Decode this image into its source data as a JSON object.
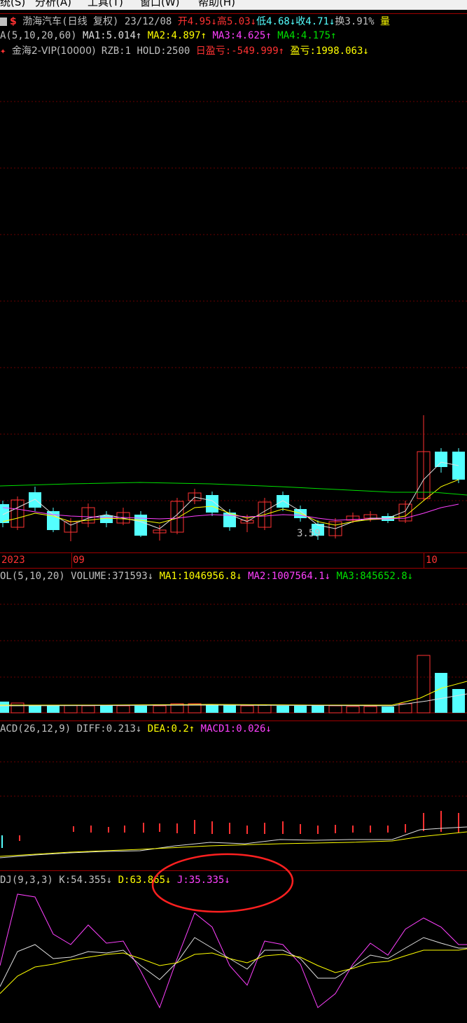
{
  "menu": [
    "统(S)",
    "分析(A)",
    "工具(T)",
    "窗口(W)",
    "帮助(H)"
  ],
  "header": {
    "title": "渤海汽车(日线 复权)",
    "date": "23/12/08",
    "open": "开4.95",
    "high": "高5.03",
    "low": "低4.68",
    "close": "收4.71",
    "turnover": "换3.91%",
    "volume_label": "量"
  },
  "ma_row": {
    "name": "A(5,10,20,60)",
    "ma1": "MA1:5.014",
    "ma2": "MA2:4.897",
    "ma3": "MA3:4.625",
    "ma4": "MA4:4.175"
  },
  "strategy_row": {
    "name": "金海2-VIP(10000)",
    "rzb": "RZB:1",
    "hold": "HOLD:2500",
    "day_pl": "日盈亏:-549.999",
    "pl": "盈亏:1998.063"
  },
  "low_marker": "3.59",
  "date_axis": [
    "2023",
    "09",
    "10"
  ],
  "vol_row": {
    "name": "OL(5,10,20)",
    "volume": "VOLUME:371593",
    "ma1": "MA1:1046956.8",
    "ma2": "MA2:1007564.1",
    "ma3": "MA3:845652.8"
  },
  "macd_row": {
    "name": "ACD(26,12,9)",
    "diff": "DIFF:0.213",
    "dea": "DEA:0.2",
    "macd": "MACD1:0.026"
  },
  "kdj_row": {
    "name": "DJ(9,3,3)",
    "k": "K:54.355",
    "d": "D:63.865",
    "j": "J:35.335"
  },
  "colors": {
    "up": "#ff3232",
    "down": "#54ffff",
    "ma1": "#e0e0e0",
    "ma2": "#ffff00",
    "ma3": "#ff40ff",
    "ma4": "#00e000",
    "annotation": "#ff2020"
  },
  "arrows": {
    "up": "↑",
    "down": "↓"
  }
}
